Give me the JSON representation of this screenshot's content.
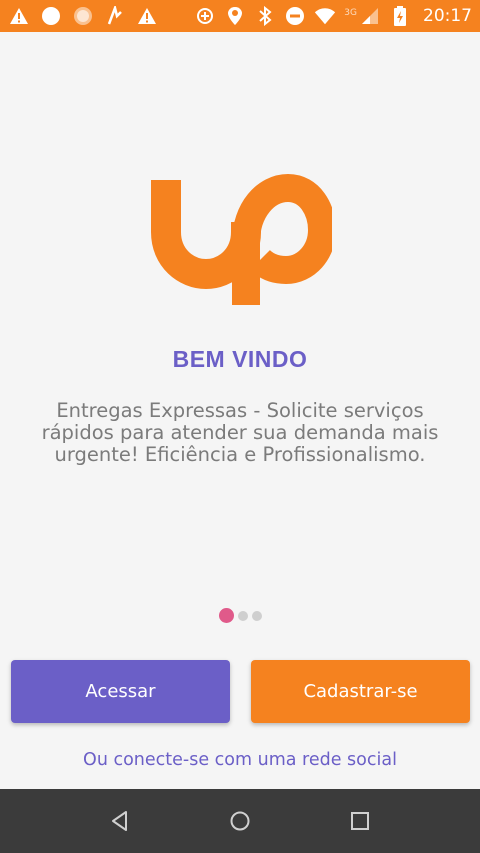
{
  "status_bar": {
    "time": "20:17",
    "network": "3G",
    "background_color": "#f5821f",
    "left_icons": [
      "warning-icon",
      "circle-icon",
      "circle-faded-icon",
      "lightning-icon",
      "warning-icon"
    ],
    "right_icons": [
      "gps-icon",
      "location-icon",
      "bluetooth-icon",
      "do-not-disturb-icon",
      "wifi-icon",
      "signal-icon",
      "battery-icon"
    ]
  },
  "welcome": {
    "title": "BEM VINDO",
    "description": "Entregas Expressas - Solicite serviços rápidos para atender sua demanda mais urgente! Eficiência e Profissionalismo."
  },
  "pager": {
    "pages": 3,
    "active_index": 0
  },
  "buttons": {
    "access_label": "Acessar",
    "signup_label": "Cadastrar-se"
  },
  "social_link": "Ou conecte-se com uma rede social",
  "colors": {
    "brand_orange": "#f5821f",
    "brand_purple": "#6b5fc7",
    "active_dot": "#e05a8a"
  },
  "nav_bar": {
    "icons": [
      "back-icon",
      "home-icon",
      "recents-icon"
    ]
  }
}
